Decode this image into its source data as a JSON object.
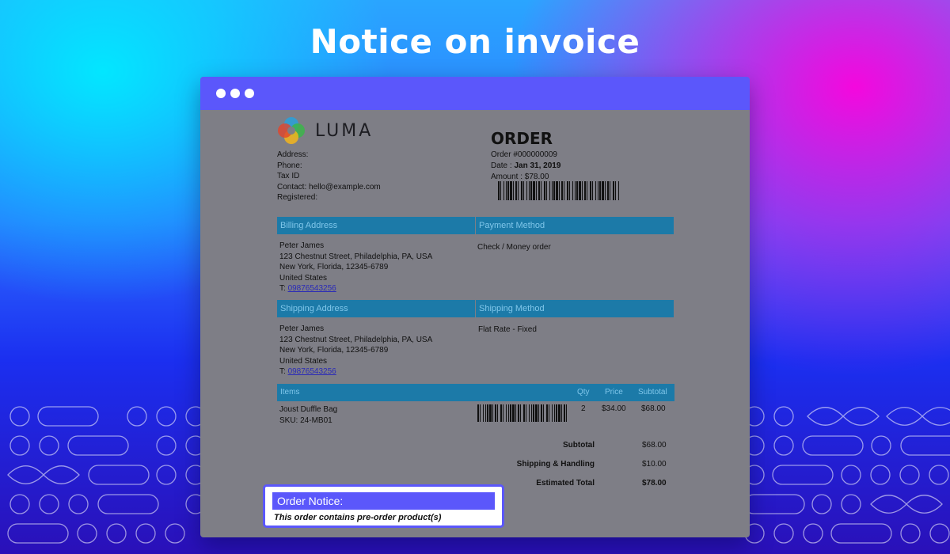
{
  "heading": "Notice on invoice",
  "colors": {
    "accent": "#5b57fb",
    "section_header": "#1c7aa8",
    "section_header_text": "#7fc6ea",
    "link": "#2a2ab8"
  },
  "store": {
    "brand": "LUMA",
    "address": "Address:",
    "phone": "Phone:",
    "tax_id": "Tax ID",
    "contact": "Contact: hello@example.com",
    "registered": "Registered:"
  },
  "order": {
    "title": "ORDER",
    "number": "Order #000000009",
    "date_label": "Date : ",
    "date_value": "Jan 31, 2019",
    "amount": "Amount : $78.00"
  },
  "billing": {
    "header": "Billing Address",
    "name": "Peter James",
    "street": "123 Chestnut Street, Philadelphia, PA, USA",
    "city": "New York, Florida, 12345-6789",
    "country": "United States",
    "phone_label": "T: ",
    "phone": "09876543256"
  },
  "payment": {
    "header": "Payment Method",
    "value": "Check / Money order"
  },
  "shipping": {
    "header": "Shipping Address",
    "name": "Peter James",
    "street": "123 Chestnut Street, Philadelphia, PA, USA",
    "city": "New York, Florida, 12345-6789",
    "country": "United States",
    "phone_label": "T: ",
    "phone": "09876543256"
  },
  "shipping_method": {
    "header": "Shipping Method",
    "value": "Flat Rate - Fixed"
  },
  "items": {
    "headers": {
      "items": "Items",
      "qty": "Qty",
      "price": "Price",
      "subtotal": "Subtotal"
    },
    "rows": [
      {
        "name": "Joust Duffle Bag",
        "sku": "SKU: 24-MB01",
        "qty": "2",
        "price": "$34.00",
        "subtotal": "$68.00"
      }
    ]
  },
  "totals": {
    "subtotal_label": "Subtotal",
    "subtotal": "$68.00",
    "shipping_label": "Shipping & Handling",
    "shipping": "$10.00",
    "total_label": "Estimated Total",
    "total": "$78.00"
  },
  "notice": {
    "header": "Order Notice:",
    "text": "This order contains pre-order product(s)"
  }
}
